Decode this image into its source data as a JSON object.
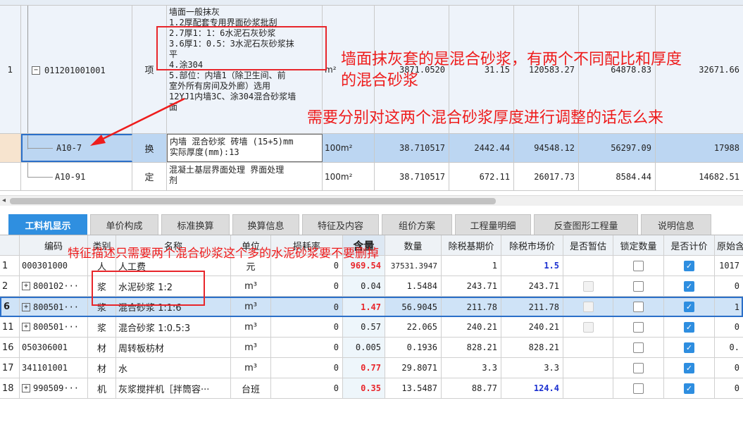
{
  "top_grid": {
    "rows": [
      {
        "num": "1",
        "expander": "−",
        "code": "011201001001",
        "category": "项",
        "desc_lines": [
          "墙面一般抹灰",
          "1.2厚配套专用界面砂浆批刮",
          "2.7厚1：1：6水泥石灰砂浆",
          "3.6厚1：0.5：3水泥石灰砂浆抹",
          "平",
          "4.涂304",
          "5.部位：内墙1（除卫生间、前",
          "室外所有房间及外廊）选用",
          "12YJ1内墙3C、涂304混合砂浆墙",
          "面"
        ],
        "unit": "m²",
        "qty": "3871.0520",
        "price": "31.15",
        "total": "120583.27",
        "c1": "64878.83",
        "c2": "32671.66"
      },
      {
        "code": "A10-7",
        "category": "换",
        "desc_lines": [
          "内墙 混合砂浆 砖墙 (15+5)mm",
          " 实际厚度(mm):13"
        ],
        "unit": "100m²",
        "qty": "38.710517",
        "price": "2442.44",
        "total": "94548.12",
        "c1": "56297.09",
        "c2": "17988"
      },
      {
        "code": "A10-91",
        "category": "定",
        "desc_lines": [
          "混凝土基层界面处理 界面处理",
          "剂"
        ],
        "unit": "100m²",
        "qty": "38.710517",
        "price": "672.11",
        "total": "26017.73",
        "c1": "8584.44",
        "c2": "14682.51"
      }
    ],
    "scroll_arrow": "◂"
  },
  "tabs": [
    {
      "label": "工料机显示",
      "active": true
    },
    {
      "label": "单价构成"
    },
    {
      "label": "标准换算"
    },
    {
      "label": "换算信息"
    },
    {
      "label": "特征及内容"
    },
    {
      "label": "组价方案"
    },
    {
      "label": "工程量明细"
    },
    {
      "label": "反查图形工程量"
    },
    {
      "label": "说明信息"
    }
  ],
  "bottom_grid": {
    "headers": [
      "编码",
      "类别",
      "名称",
      "单位",
      "损耗率",
      "含量",
      "数量",
      "除税基期价",
      "除税市场价",
      "是否暂估",
      "锁定数量",
      "是否计价",
      "原始含"
    ],
    "rows": [
      {
        "num": "1",
        "code": "000301000",
        "type": "人",
        "name": "人工费",
        "unit": "元",
        "loss": "0",
        "content": "969.54",
        "qty": "37531.3947",
        "base": "1",
        "market": "1.5",
        "estimate": "none",
        "locked": false,
        "priced": true,
        "orig": "1017"
      },
      {
        "num": "2",
        "plus": "+",
        "code": "800102···",
        "type": "浆",
        "name": "水泥砂浆 1:2",
        "unit": "m³",
        "loss": "0",
        "content": "0.04",
        "qty": "1.5484",
        "base": "243.71",
        "market": "243.71",
        "estimate": "dis",
        "locked": false,
        "priced": true,
        "orig": "0"
      },
      {
        "num": "6",
        "plus": "+",
        "code": "800501···",
        "type": "浆",
        "name": "混合砂浆 1:1:6",
        "unit": "m³",
        "loss": "0",
        "content": "1.47",
        "qty": "56.9045",
        "base": "211.78",
        "market": "211.78",
        "estimate": "dis",
        "locked": false,
        "priced": true,
        "orig": "1"
      },
      {
        "num": "11",
        "plus": "+",
        "code": "800501···",
        "type": "浆",
        "name": "混合砂浆 1:0.5:3",
        "unit": "m³",
        "loss": "0",
        "content": "0.57",
        "qty": "22.065",
        "base": "240.21",
        "market": "240.21",
        "estimate": "dis",
        "locked": false,
        "priced": true,
        "orig": "0"
      },
      {
        "num": "16",
        "code": "050306001",
        "type": "材",
        "name": "周转板枋材",
        "unit": "m³",
        "loss": "0",
        "content": "0.005",
        "qty": "0.1936",
        "base": "828.21",
        "market": "828.21",
        "estimate": "none",
        "locked": false,
        "priced": true,
        "orig": "0."
      },
      {
        "num": "17",
        "code": "341101001",
        "type": "材",
        "name": "水",
        "unit": "m³",
        "loss": "0",
        "content": "0.77",
        "qty": "29.8071",
        "base": "3.3",
        "market": "3.3",
        "estimate": "none",
        "locked": false,
        "priced": true,
        "orig": "0"
      },
      {
        "num": "18",
        "plus": "+",
        "code": "990509···",
        "type": "机",
        "name": "灰浆搅拌机［拌筒容···",
        "unit": "台班",
        "loss": "0",
        "content": "0.35",
        "qty": "13.5487",
        "base": "88.77",
        "market": "124.4",
        "estimate": "none",
        "locked": false,
        "priced": true,
        "orig": "0"
      }
    ]
  },
  "annotations": {
    "note1_line1": "墙面抹灰套的是混合砂浆，有两个不同配比和厚度",
    "note1_line2": "的混合砂浆",
    "note2": "需要分别对这两个混合砂浆厚度进行调整的话怎么来",
    "note3": "特征描述只需要两个混合砂浆这个多的水泥砂浆要不要删掉",
    "color": "#ee1c1c"
  }
}
